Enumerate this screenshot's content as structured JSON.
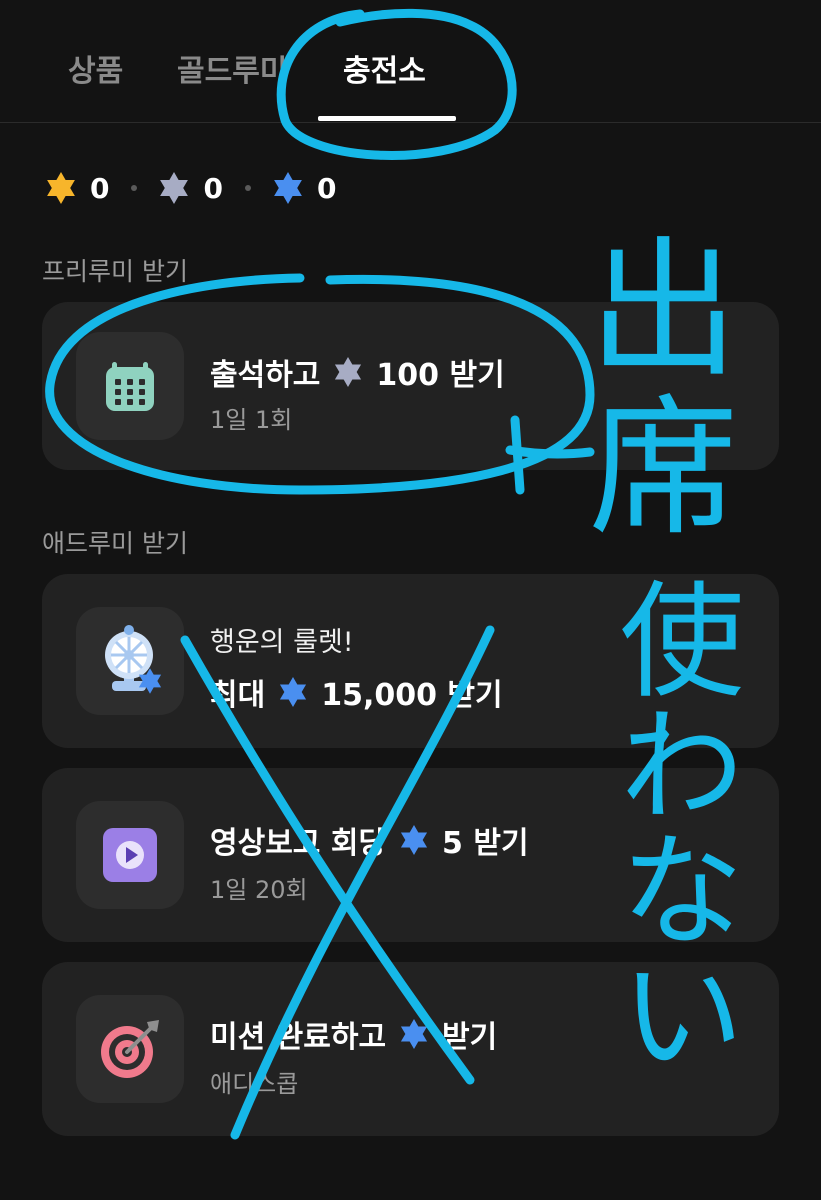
{
  "tabs": [
    {
      "label": "상품"
    },
    {
      "label": "골드루미"
    },
    {
      "label": "충전소"
    }
  ],
  "balance": {
    "gold": "0",
    "silver": "0",
    "blue": "0",
    "colors": {
      "gold": "#f7b52b",
      "silver": "#a7acc4",
      "blue": "#4a8ff0"
    }
  },
  "sections": {
    "free": "프리루미 받기",
    "ad": "애드루미 받기"
  },
  "cards": {
    "attendance": {
      "title_pre": "출석하고",
      "title_post": "100 받기",
      "sub": "1일 1회",
      "icon": "calendar-icon"
    },
    "roulette": {
      "pre": "행운의 룰렛!",
      "title_pre": "최대",
      "title_post": "15,000 받기",
      "icon": "roulette-icon"
    },
    "video": {
      "title_pre": "영상보고 회당",
      "title_post": "5 받기",
      "sub": "1일 20회",
      "icon": "play-icon"
    },
    "mission": {
      "title_pre": "미션 완료하고",
      "title_post": "받기",
      "sub": "애디스콥",
      "icon": "target-icon"
    }
  },
  "annotation": {
    "text_top": "出席",
    "text_bottom": "使わない",
    "color": "#16b8e8"
  }
}
